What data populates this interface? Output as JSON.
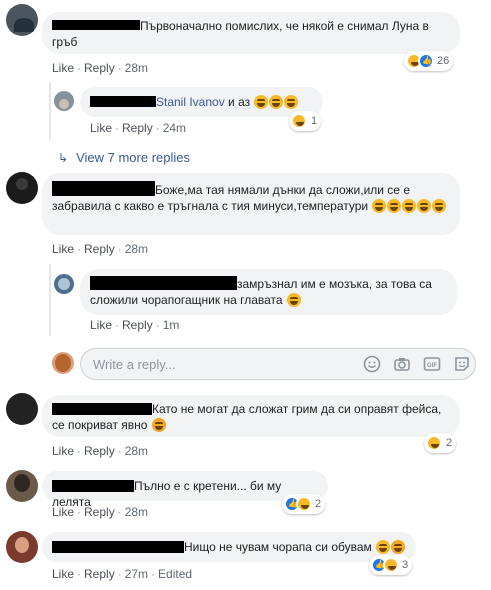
{
  "actions": {
    "like": "Like",
    "reply": "Reply",
    "dot": "·",
    "edited": "Edited"
  },
  "comments": [
    {
      "text": "Първоначално помислих, че някой е снимал Луна в гръб",
      "time": "28m",
      "reactions_count": "26"
    },
    {
      "reply_name": "Stanil Ivanov",
      "text": " и аз",
      "time": "24m",
      "reactions_count": "1"
    },
    {
      "view_more": "View 7 more replies"
    },
    {
      "text": "Боже,ма тая нямали дънки да сложи,или се е забравила с какво е тръгнала с тия минуси,температури",
      "time": "28m"
    },
    {
      "text": "замръзнал им е мозъка, за това са сложили чорапогащник на главата",
      "time": "1m"
    },
    {
      "placeholder": "Write a reply..."
    },
    {
      "text": "Като не могат да сложат грим да си оправят фейса, се покриват явно",
      "time": "28m",
      "reactions_count": "2"
    },
    {
      "text": "Пълно е с кретени... би му лелята",
      "time": "28m",
      "reactions_count": "2"
    },
    {
      "text": "Нищо не чувам чорапа си обувам",
      "time": "27m",
      "reactions_count": "3"
    }
  ],
  "colors": {
    "link": "#385898",
    "bubble": "#f2f3f5",
    "like_blue": "#1877f2",
    "haha_yellow": "#f7b928"
  }
}
